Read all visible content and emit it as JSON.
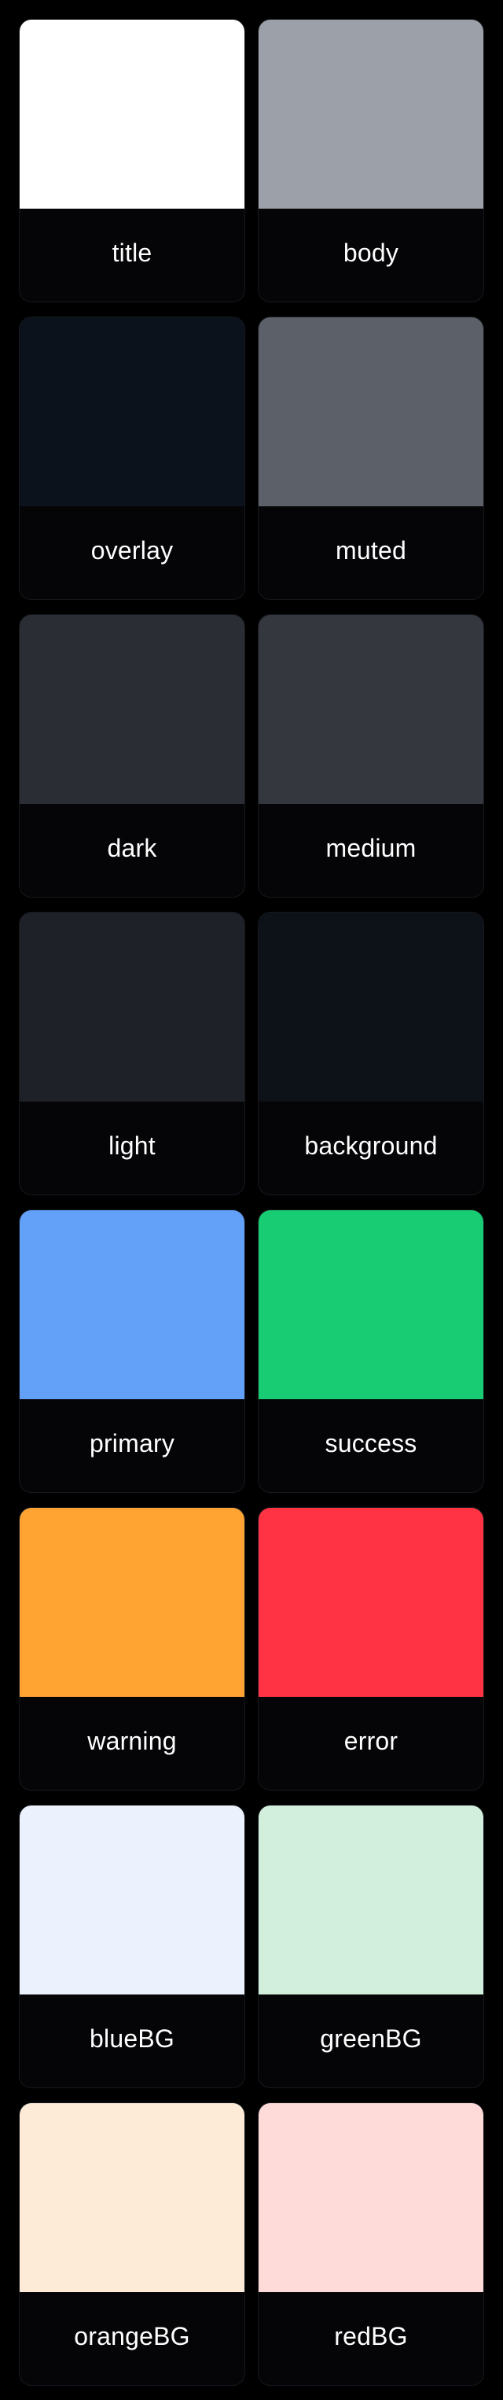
{
  "palette": {
    "cards": [
      {
        "name": "title",
        "color": "#FFFFFF"
      },
      {
        "name": "body",
        "color": "#9CA0A8"
      },
      {
        "name": "overlay",
        "color": "#0B121C"
      },
      {
        "name": "muted",
        "color": "#5C6068"
      },
      {
        "name": "dark",
        "color": "#2A2D33"
      },
      {
        "name": "medium",
        "color": "#35373E"
      },
      {
        "name": "light",
        "color": "#1E2128"
      },
      {
        "name": "background",
        "color": "#0D1118"
      },
      {
        "name": "primary",
        "color": "#63A0F8"
      },
      {
        "name": "success",
        "color": "#17CC72"
      },
      {
        "name": "warning",
        "color": "#FFA333"
      },
      {
        "name": "error",
        "color": "#FF3344"
      },
      {
        "name": "blueBG",
        "color": "#EBF2FD"
      },
      {
        "name": "greenBG",
        "color": "#D2EEDD"
      },
      {
        "name": "orangeBG",
        "color": "#FDEBD8"
      },
      {
        "name": "redBG",
        "color": "#FEDAD8"
      }
    ]
  }
}
